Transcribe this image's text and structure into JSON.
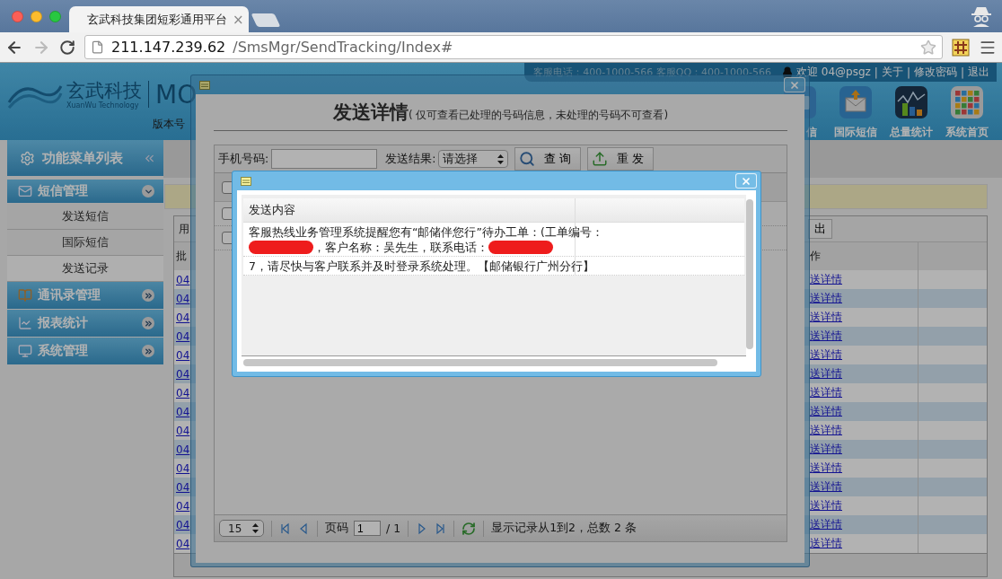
{
  "browser": {
    "tabs": [
      {
        "title": "玄武科技集团短彩通用平台",
        "close": "×",
        "selected": true
      }
    ],
    "url_host": "211.147.239.62",
    "url_path": "/SmsMgr/SendTracking/Index#"
  },
  "header": {
    "logo_cn": "玄武科技",
    "logo_en": "XuanWu Technology",
    "product": "MO",
    "version_label": "版本号",
    "service_info": "客服电话：400-1000-566  客服QQ：400-1000-566",
    "welcome": "欢迎 04@psgz",
    "separator": "|",
    "links": [
      "关于",
      "修改密码",
      "退出"
    ],
    "nav": [
      {
        "label": "信",
        "kind": "sms"
      },
      {
        "label": "国际短信",
        "kind": "intl"
      },
      {
        "label": "总量统计",
        "kind": "stats"
      },
      {
        "label": "系统首页",
        "kind": "home"
      }
    ]
  },
  "sidebar": {
    "title": "功能菜单列表",
    "groups": [
      {
        "label": "短信管理",
        "kind": "mail",
        "expanded": true,
        "items": [
          {
            "label": "发送短信",
            "selected": false
          },
          {
            "label": "国际短信",
            "selected": false
          },
          {
            "label": "发送记录",
            "selected": true
          }
        ]
      },
      {
        "label": "通讯录管理",
        "kind": "book",
        "expanded": false
      },
      {
        "label": "报表统计",
        "kind": "chart",
        "expanded": false
      },
      {
        "label": "系统管理",
        "kind": "monitor",
        "expanded": false
      }
    ]
  },
  "records": {
    "toolbar_text": "用",
    "export_button": "出",
    "columns": [
      "批",
      "作"
    ],
    "rows": [
      {
        "batch": "04",
        "action": "送详情"
      },
      {
        "batch": "04",
        "action": "送详情"
      },
      {
        "batch": "04",
        "action": "送详情"
      },
      {
        "batch": "04",
        "action": "送详情"
      },
      {
        "batch": "04",
        "action": "送详情"
      },
      {
        "batch": "04",
        "action": "送详情"
      },
      {
        "batch": "04",
        "action": "送详情"
      },
      {
        "batch": "04",
        "action": "送详情"
      },
      {
        "batch": "04",
        "action": "送详情"
      },
      {
        "batch": "04",
        "action": "送详情"
      },
      {
        "batch": "04",
        "action": "送详情"
      },
      {
        "batch": "04",
        "action": "送详情"
      },
      {
        "batch": "04",
        "action": "送详情"
      },
      {
        "batch": "04",
        "action": "送详情"
      },
      {
        "batch": "04",
        "action": "送详情"
      }
    ]
  },
  "detail_dialog": {
    "title": "发送详情",
    "subtitle": "( 仅可查看已处理的号码信息，未处理的号码不可查看)",
    "phone_label": "手机号码:",
    "result_label": "发送结果:",
    "result_value": "请选择",
    "buttons": [
      {
        "label": "查 询",
        "kind": "search"
      },
      {
        "label": "重 发",
        "kind": "resend"
      }
    ],
    "header_checked": false,
    "rows": [
      {
        "checked": false
      },
      {
        "checked": false
      }
    ],
    "pager": {
      "page_size": "15",
      "page_label": "页码",
      "page": "1",
      "total_pages": "/ 1",
      "summary": "显示记录从1到2，总数 2 条"
    }
  },
  "content_dialog": {
    "columns": [
      "发送内容"
    ],
    "rows": [
      {
        "lines": [
          [
            {
              "kind": "text",
              "text": "客服热线业务管理系统提醒您有“邮储伴您行”待办工单：(工单编号："
            }
          ],
          [
            {
              "kind": "redacted"
            },
            {
              "kind": "text",
              "text": "，客户名称：吴先生，联系电话："
            },
            {
              "kind": "redacted"
            }
          ]
        ]
      },
      {
        "lines": [
          [
            {
              "kind": "text",
              "text": "7，请尽快与客户联系并及时登录系统处理。【邮储银行广州分行】"
            }
          ]
        ]
      }
    ]
  }
}
